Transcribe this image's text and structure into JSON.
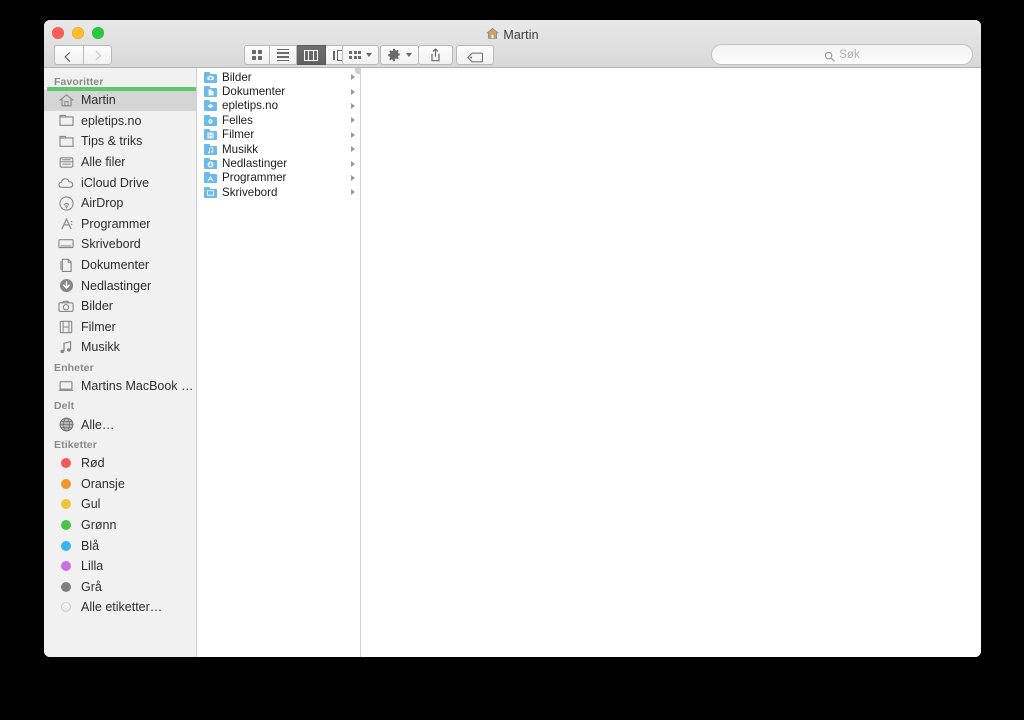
{
  "window": {
    "title": "Martin",
    "title_icon": "home-icon",
    "traffic_lights": [
      {
        "name": "close",
        "color": "#ff5f57"
      },
      {
        "name": "minimize",
        "color": "#ffbd2e"
      },
      {
        "name": "maximize",
        "color": "#28c940"
      }
    ]
  },
  "toolbar": {
    "back_label": "Back",
    "forward_label": "Forward",
    "view_modes": [
      {
        "name": "icon-view",
        "label": "Icon View",
        "selected": false
      },
      {
        "name": "list-view",
        "label": "List View",
        "selected": false
      },
      {
        "name": "column-view",
        "label": "Column View",
        "selected": true
      },
      {
        "name": "coverflow-view",
        "label": "Cover Flow View",
        "selected": false
      }
    ],
    "arrange_label": "Arrange",
    "action_label": "Action",
    "share_label": "Share",
    "tag_label": "Tags"
  },
  "search": {
    "placeholder": "Søk",
    "value": ""
  },
  "sidebar": {
    "sections": [
      {
        "name": "favoritter",
        "header": "Favoritter",
        "has_progress_bar": true,
        "progress_color": "#5cc86c",
        "items": [
          {
            "label": "Martin",
            "icon": "home-icon",
            "selected": true
          },
          {
            "label": "epletips.no",
            "icon": "folder-icon",
            "selected": false
          },
          {
            "label": "Tips & triks",
            "icon": "folder-icon",
            "selected": false
          },
          {
            "label": "Alle filer",
            "icon": "all-files-icon",
            "selected": false
          },
          {
            "label": "iCloud Drive",
            "icon": "cloud-icon",
            "selected": false
          },
          {
            "label": "AirDrop",
            "icon": "airdrop-icon",
            "selected": false
          },
          {
            "label": "Programmer",
            "icon": "applications-icon",
            "selected": false
          },
          {
            "label": "Skrivebord",
            "icon": "desktop-icon",
            "selected": false
          },
          {
            "label": "Dokumenter",
            "icon": "documents-icon",
            "selected": false
          },
          {
            "label": "Nedlastinger",
            "icon": "downloads-icon",
            "selected": false
          },
          {
            "label": "Bilder",
            "icon": "pictures-icon",
            "selected": false
          },
          {
            "label": "Filmer",
            "icon": "movies-icon",
            "selected": false
          },
          {
            "label": "Musikk",
            "icon": "music-icon",
            "selected": false
          }
        ]
      },
      {
        "name": "enheter",
        "header": "Enheter",
        "has_progress_bar": false,
        "items": [
          {
            "label": "Martins MacBook P…",
            "icon": "laptop-icon",
            "selected": false
          }
        ]
      },
      {
        "name": "delt",
        "header": "Delt",
        "has_progress_bar": false,
        "items": [
          {
            "label": "Alle…",
            "icon": "network-globe-icon",
            "selected": false
          }
        ]
      },
      {
        "name": "etiketter",
        "header": "Etiketter",
        "has_progress_bar": false,
        "items": [
          {
            "label": "Rød",
            "icon": "tag-dot-icon",
            "color": "#f4585a",
            "selected": false
          },
          {
            "label": "Oransje",
            "icon": "tag-dot-icon",
            "color": "#f1962e",
            "selected": false
          },
          {
            "label": "Gul",
            "icon": "tag-dot-icon",
            "color": "#f3c23c",
            "selected": false
          },
          {
            "label": "Grønn",
            "icon": "tag-dot-icon",
            "color": "#4cc34c",
            "selected": false
          },
          {
            "label": "Blå",
            "icon": "tag-dot-icon",
            "color": "#39b3ed",
            "selected": false
          },
          {
            "label": "Lilla",
            "icon": "tag-dot-icon",
            "color": "#cc6ee0",
            "selected": false
          },
          {
            "label": "Grå",
            "icon": "tag-dot-icon",
            "color": "#808080",
            "selected": false
          },
          {
            "label": "Alle etiketter…",
            "icon": "tag-dot-hollow-icon",
            "color": "#efefef",
            "selected": false
          }
        ]
      }
    ]
  },
  "columns": [
    {
      "name": "column-martin",
      "rows": [
        {
          "label": "Bilder",
          "icon": "folder-pictures-icon",
          "has_children": true
        },
        {
          "label": "Dokumenter",
          "icon": "folder-documents-icon",
          "has_children": true
        },
        {
          "label": "epletips.no",
          "icon": "folder-dropbox-icon",
          "has_children": true
        },
        {
          "label": "Felles",
          "icon": "folder-shared-icon",
          "has_children": true
        },
        {
          "label": "Filmer",
          "icon": "folder-movies-icon",
          "has_children": true
        },
        {
          "label": "Musikk",
          "icon": "folder-music-icon",
          "has_children": true
        },
        {
          "label": "Nedlastinger",
          "icon": "folder-downloads-icon",
          "has_children": true
        },
        {
          "label": "Programmer",
          "icon": "folder-applications-icon",
          "has_children": true
        },
        {
          "label": "Skrivebord",
          "icon": "folder-desktop-icon",
          "has_children": true
        }
      ]
    }
  ],
  "colors": {
    "folder_blue": "#6db9e8",
    "sidebar_bg": "#f1f1f1",
    "selection_gray": "#d5d5d5",
    "accent_green": "#5cc86c"
  }
}
